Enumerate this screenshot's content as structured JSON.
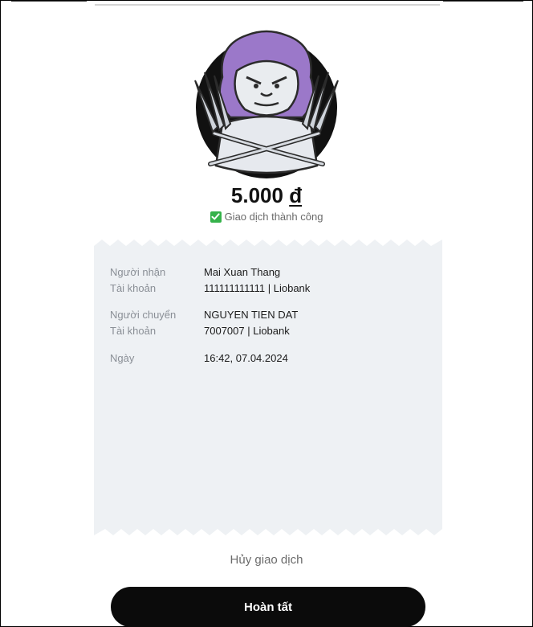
{
  "amount": {
    "value": "5.000",
    "currency": "đ"
  },
  "status": {
    "text": "Giao dịch thành công",
    "icon": "check-square-icon",
    "color": "#35b24a"
  },
  "receipt": {
    "rows": [
      {
        "label": "Người nhận",
        "value": "Mai Xuan Thang"
      },
      {
        "label": "Tài khoản",
        "value": "111111111111 | Liobank"
      },
      {
        "label": "Người chuyển",
        "value": "NGUYEN TIEN DAT"
      },
      {
        "label": "Tài khoản",
        "value": "7007007 | Liobank"
      },
      {
        "label": "Ngày",
        "value": "16:42, 07.04.2024"
      }
    ]
  },
  "actions": {
    "cancel_label": "Hủy giao dịch",
    "done_label": "Hoàn tất"
  },
  "mascot": {
    "icon": "lion-mascot-icon",
    "mane_color": "#9b78c9"
  }
}
